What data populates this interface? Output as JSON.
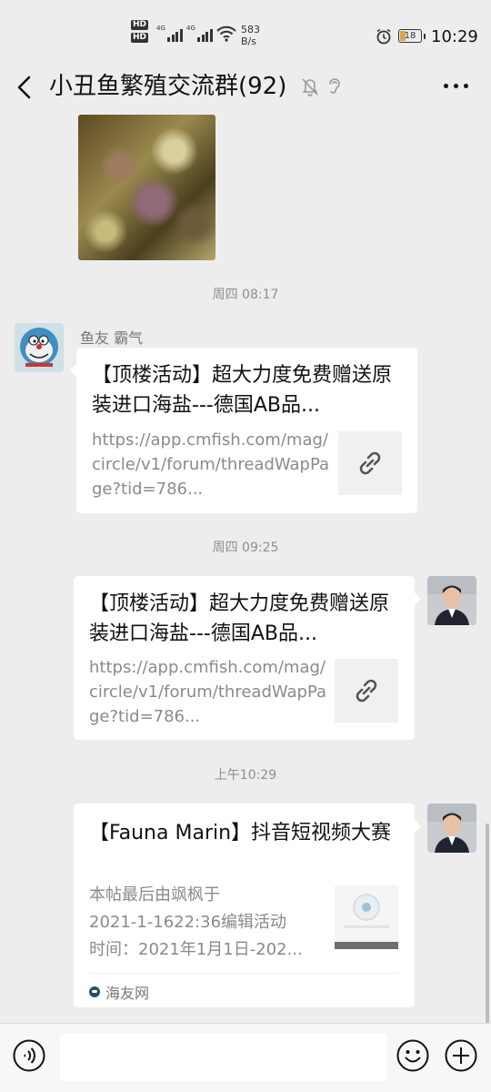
{
  "status_bar": {
    "net1": "HD",
    "net2": "HD",
    "sig1_label": "4G",
    "sig2_label": "4G",
    "speed_value": "583",
    "speed_unit": "B/s",
    "battery": "18",
    "time": "10:29",
    "icons": [
      "wifi-icon",
      "alarm-icon"
    ]
  },
  "header": {
    "title": "小丑鱼繁殖交流群(92)",
    "icons": [
      "back-icon",
      "mute-bell-icon",
      "earpiece-icon",
      "more-icon"
    ]
  },
  "messages": {
    "ts1": "周四 08:17",
    "sender_name": "鱼友 霸气",
    "card1": {
      "title": "【顶楼活动】超大力度免费赠送原装进口海盐---德国AB品...",
      "desc": "https://app.cmfish.com/mag/circle/v1/forum/threadWapPage?tid=786...",
      "icon": "link-icon"
    },
    "ts2": "周四 09:25",
    "card2": {
      "title": "【顶楼活动】超大力度免费赠送原装进口海盐---德国AB品...",
      "desc": "https://app.cmfish.com/mag/circle/v1/forum/threadWapPage?tid=786...",
      "icon": "link-icon"
    },
    "ts3": "上午10:29",
    "card3": {
      "title": "【Fauna Marin】抖音短视频大赛",
      "desc_line1": "本帖最后由飒枫于",
      "desc_line2": "2021-1-1622:36编辑活动",
      "desc_line3": "时间：2021年1月1日-202...",
      "source": "海友网"
    }
  },
  "input_bar": {
    "icons": [
      "voice-icon",
      "emoji-icon",
      "plus-icon"
    ],
    "value": ""
  }
}
